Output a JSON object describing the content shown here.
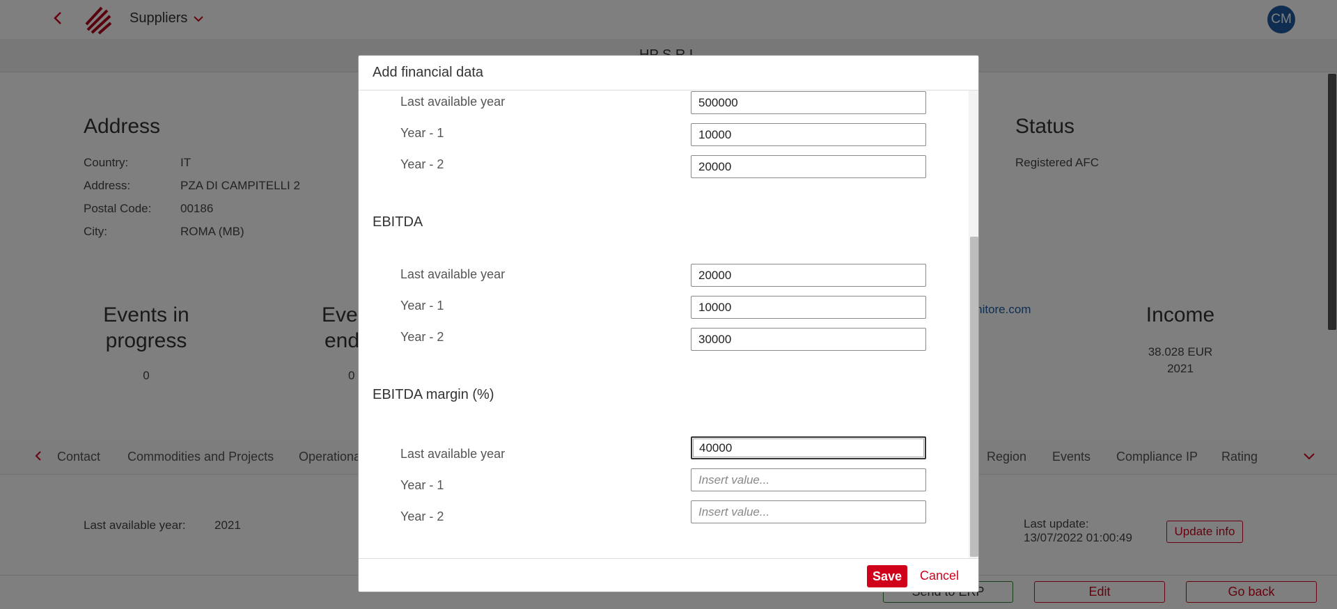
{
  "header": {
    "breadcrumb": "Suppliers",
    "avatar_initials": "CM",
    "subtitle": "HP S.R.L."
  },
  "address": {
    "title": "Address",
    "rows": [
      {
        "label": "Country:",
        "value": "IT"
      },
      {
        "label": "Address:",
        "value": "PZA DI CAMPITELLI 2"
      },
      {
        "label": "Postal Code:",
        "value": "00186"
      },
      {
        "label": "City:",
        "value": "ROMA (MB)"
      }
    ]
  },
  "status": {
    "title": "Status",
    "value": "Registered AFC"
  },
  "kpis": {
    "events_in_progress": {
      "title_line1": "Events in",
      "title_line2": "progress",
      "value": "0"
    },
    "events_ended": {
      "title_line1": "Even",
      "title_line2": "end",
      "value": "0"
    },
    "email_fragment": "ornitore.com",
    "income": {
      "title": "Income",
      "value_line1": "38.028 EUR",
      "value_line2": "2021"
    }
  },
  "tabs": [
    "Contact",
    "Commodities and Projects",
    "Operational",
    "Region",
    "Events",
    "Compliance IP",
    "Rating"
  ],
  "financial": {
    "last_available_year_label": "Last available year:",
    "last_available_year_value": "2021",
    "last_update_label": "Last update:",
    "last_update_value": "13/07/2022 01:00:49",
    "update_button": "Update info"
  },
  "footer": {
    "send_erp": "Send to ERP",
    "edit": "Edit",
    "go_back": "Go back"
  },
  "modal": {
    "title": "Add financial data",
    "labels": {
      "last_year": "Last available year",
      "year_1": "Year - 1",
      "year_2": "Year - 2"
    },
    "top_group": {
      "last_year": "500000",
      "year_1": "10000",
      "year_2": "20000"
    },
    "ebitda": {
      "title": "EBITDA",
      "last_year": "20000",
      "year_1": "10000",
      "year_2": "30000"
    },
    "ebitda_margin": {
      "title": "EBITDA margin (%)",
      "last_year": "40000",
      "year_1": "",
      "year_2": ""
    },
    "placeholder": "Insert value...",
    "save": "Save",
    "cancel": "Cancel"
  }
}
